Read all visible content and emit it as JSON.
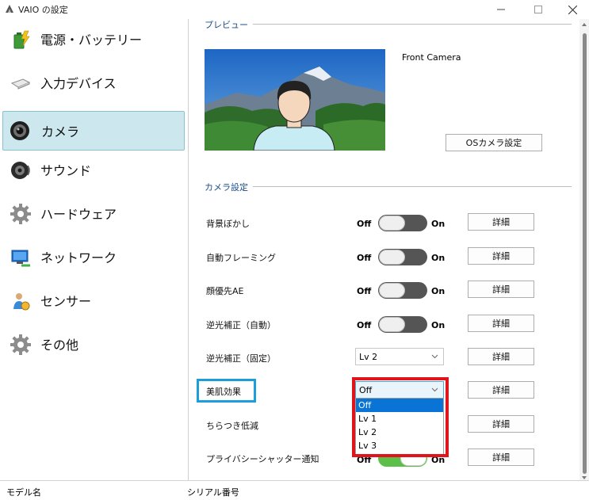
{
  "window": {
    "title": "VAIO の設定"
  },
  "sidebar": {
    "items": [
      {
        "label": "電源・バッテリー",
        "icon": "battery-icon"
      },
      {
        "label": "入力デバイス",
        "icon": "input-device-icon"
      },
      {
        "label": "カメラ",
        "icon": "camera-icon",
        "selected": true
      },
      {
        "label": "サウンド",
        "icon": "speaker-icon"
      },
      {
        "label": "ハードウェア",
        "icon": "gear-icon"
      },
      {
        "label": "ネットワーク",
        "icon": "network-icon"
      },
      {
        "label": "センサー",
        "icon": "sensor-icon"
      },
      {
        "label": "その他",
        "icon": "gear-icon"
      }
    ]
  },
  "preview": {
    "section_title": "プレビュー",
    "camera_name": "Front Camera",
    "os_settings_button": "OSカメラ設定"
  },
  "camera_settings": {
    "section_title": "カメラ設定",
    "toggle_off_label": "Off",
    "toggle_on_label": "On",
    "detail_label": "詳細",
    "rows": [
      {
        "label": "背景ぼかし",
        "control": "toggle",
        "state": "off"
      },
      {
        "label": "自動フレーミング",
        "control": "toggle",
        "state": "off"
      },
      {
        "label": "顔優先AE",
        "control": "toggle",
        "state": "off"
      },
      {
        "label": "逆光補正（自動）",
        "control": "toggle",
        "state": "off"
      },
      {
        "label": "逆光補正（固定）",
        "control": "select",
        "value": "Lv 2"
      },
      {
        "label": "美肌効果",
        "control": "select",
        "value": "Off",
        "open": true
      },
      {
        "label": "ちらつき低減",
        "control": "select"
      },
      {
        "label": "プライバシーシャッター通知",
        "control": "toggle",
        "state": "on"
      }
    ],
    "dropdown_options": [
      "Off",
      "Lv 1",
      "Lv 2",
      "Lv 3"
    ],
    "dropdown_selected": "Off"
  },
  "statusbar": {
    "model_label": "モデル名",
    "serial_label": "シリアル番号"
  },
  "colors": {
    "selected_nav_bg": "#cce8ee",
    "toggle_on": "#5cbf4a",
    "toggle_off": "#555555",
    "dropdown_selected": "#0a74d6",
    "highlight_red": "#e0141b",
    "highlight_blue": "#1a9fdb",
    "section_title": "#1a4f8a"
  }
}
